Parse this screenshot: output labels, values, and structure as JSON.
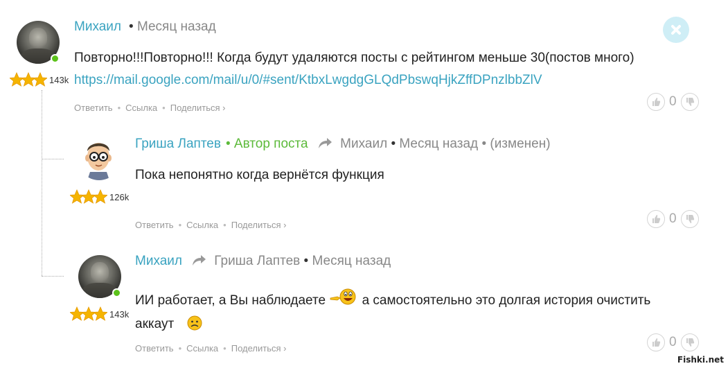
{
  "comments": [
    {
      "author": "Михаил",
      "sep": "•",
      "time": "Месяц назад",
      "text": "Повторно!!!Повторно!!! Когда будут удаляются посты с рейтингом меньше 30(постов много)",
      "link": "https://mail.google.com/mail/u/0/#sent/KtbxLwgdgGLQdPbswqHjkZffDPnzlbbZlV",
      "rating": "143k",
      "actions": [
        "Ответить",
        "Ссылка",
        "Поделиться ›"
      ],
      "votes": "0"
    },
    {
      "author": "Гриша Лаптев",
      "badge": "• Автор поста",
      "reply_to": "Михаил",
      "sep": "•",
      "time": "Месяц назад",
      "edited": "• (изменен)",
      "text": "Пока непонятно когда вернётся функция",
      "rating": "126k",
      "actions": [
        "Ответить",
        "Ссылка",
        "Поделиться ›"
      ],
      "votes": "0"
    },
    {
      "author": "Михаил",
      "reply_to": "Гриша Лаптев",
      "sep": "•",
      "time": "Месяц назад",
      "text_part1": "ИИ работает, а Вы наблюдаете",
      "text_part2": "а самостоятельно это долгая история очистить",
      "text_line2": "аккаут",
      "rating": "143k",
      "actions": [
        "Ответить",
        "Ссылка",
        "Поделиться ›"
      ],
      "votes": "0"
    }
  ],
  "watermark": "Fishki.net",
  "colors": {
    "author": "#3aa3c0",
    "badge": "#5cba3a",
    "meta": "#888888",
    "online": "#5cc21a",
    "star": "#f5b400"
  }
}
